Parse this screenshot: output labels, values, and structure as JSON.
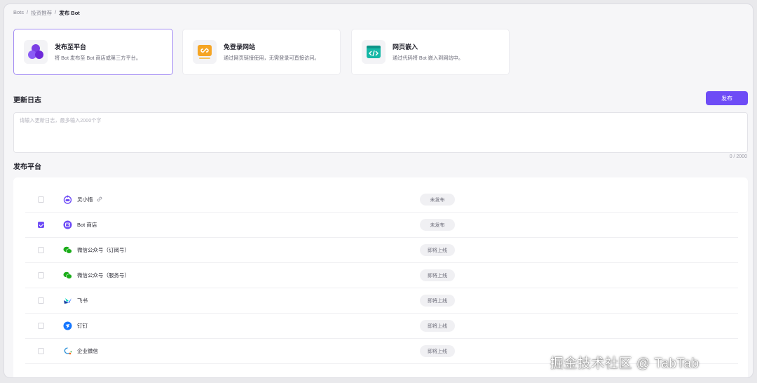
{
  "breadcrumb": [
    "Bots",
    "投资推荐",
    "发布 Bot"
  ],
  "cards": [
    {
      "title": "发布至平台",
      "desc": "将 Bot 发布至 Bot 商店或第三方平台。",
      "icon": "platform-circles-icon",
      "selected": true
    },
    {
      "title": "免登录网站",
      "desc": "通过网页链接使用，无需登录可直接访问。",
      "icon": "link-window-icon",
      "selected": false
    },
    {
      "title": "网页嵌入",
      "desc": "通过代码将 Bot 嵌入到网站中。",
      "icon": "code-embed-icon",
      "selected": false
    }
  ],
  "changelog": {
    "title": "更新日志",
    "placeholder": "请输入更新日志，最多输入2000个字",
    "counter": "0 / 2000",
    "publish_label": "发布"
  },
  "platforms": {
    "title": "发布平台",
    "items": [
      {
        "name": "灵小悟",
        "status": "未发布",
        "checked": false,
        "icon": "robot-icon",
        "link": true
      },
      {
        "name": "Bot 商店",
        "status": "未发布",
        "checked": true,
        "icon": "bot-store-icon",
        "link": false
      },
      {
        "name": "微信公众号（订阅号）",
        "status": "即将上线",
        "checked": false,
        "icon": "wechat-icon",
        "link": false
      },
      {
        "name": "微信公众号（服务号）",
        "status": "即将上线",
        "checked": false,
        "icon": "wechat-icon",
        "link": false
      },
      {
        "name": "飞书",
        "status": "即将上线",
        "checked": false,
        "icon": "feishu-icon",
        "link": false
      },
      {
        "name": "钉钉",
        "status": "即将上线",
        "checked": false,
        "icon": "dingtalk-icon",
        "link": false
      },
      {
        "name": "企业微信",
        "status": "即将上线",
        "checked": false,
        "icon": "wecom-icon",
        "link": false
      }
    ]
  },
  "watermark": "掘金技术社区 @ TabTab",
  "colors": {
    "accent": "#6e4cf6",
    "wechat": "#1aad19",
    "feishu": "#3370ff",
    "dingtalk": "#1677ff"
  }
}
